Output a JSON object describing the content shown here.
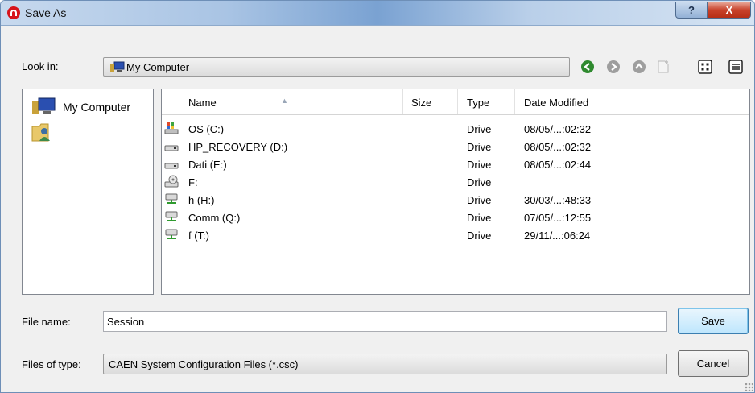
{
  "window": {
    "title": "Save As",
    "help_label": "?",
    "close_label": "X"
  },
  "look_in": {
    "label": "Look in:",
    "value": "My Computer"
  },
  "nav_icons": [
    "back-icon",
    "forward-icon",
    "up-icon",
    "new-folder-icon",
    "list-view-icon",
    "detail-view-icon"
  ],
  "sidebar": {
    "items": [
      {
        "label": "My Computer",
        "icon": "computer-icon"
      },
      {
        "label": "",
        "icon": "user-folder-icon"
      }
    ]
  },
  "file_list": {
    "columns": [
      "Name",
      "Size",
      "Type",
      "Date Modified"
    ],
    "rows": [
      {
        "name": "OS (C:)",
        "size": "",
        "type": "Drive",
        "modified": "08/05/...:02:32",
        "icon": "system-drive-icon"
      },
      {
        "name": "HP_RECOVERY (D:)",
        "size": "",
        "type": "Drive",
        "modified": "08/05/...:02:32",
        "icon": "hard-drive-icon"
      },
      {
        "name": "Dati (E:)",
        "size": "",
        "type": "Drive",
        "modified": "08/05/...:02:44",
        "icon": "hard-drive-icon"
      },
      {
        "name": "F:",
        "size": "",
        "type": "Drive",
        "modified": "",
        "icon": "optical-drive-icon"
      },
      {
        "name": "h (H:)",
        "size": "",
        "type": "Drive",
        "modified": "30/03/...:48:33",
        "icon": "network-drive-icon"
      },
      {
        "name": "Comm (Q:)",
        "size": "",
        "type": "Drive",
        "modified": "07/05/...:12:55",
        "icon": "network-drive-icon"
      },
      {
        "name": "f (T:)",
        "size": "",
        "type": "Drive",
        "modified": "29/11/...:06:24",
        "icon": "network-drive-icon"
      }
    ]
  },
  "file_name": {
    "label": "File name:",
    "value": "Session"
  },
  "file_type": {
    "label": "Files of type:",
    "value": "CAEN System Configuration Files (*.csc)"
  },
  "buttons": {
    "save": "Save",
    "cancel": "Cancel"
  }
}
